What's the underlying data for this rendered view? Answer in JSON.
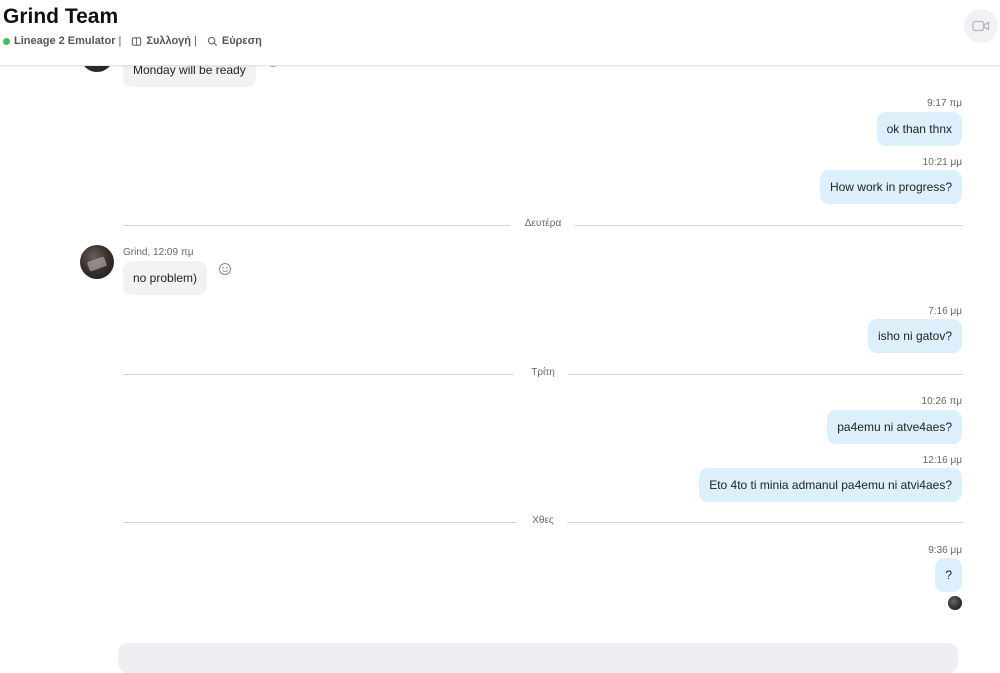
{
  "header": {
    "title": "Grind Team",
    "status_label": "Lineage 2 Emulator",
    "separator": "|",
    "collection_label": "Συλλογή",
    "find_label": "Εύρεση"
  },
  "messages": [
    {
      "text": "Monday will be ready"
    },
    {
      "time": "9:17 πμ",
      "text": "ok than thnx"
    },
    {
      "time": "10:21 μμ",
      "text": "How  work in progress?"
    },
    {
      "divider": "Δευτέρα"
    },
    {
      "sender_meta": "Grind, 12:09 πμ",
      "text": "no problem)"
    },
    {
      "time": "7:16 μμ",
      "text": "isho ni gatov?"
    },
    {
      "divider": "Τρίτη"
    },
    {
      "time": "10:26 πμ",
      "text": "pa4emu ni atve4aes?"
    },
    {
      "time": "12:16 μμ",
      "text": "Eto 4to ti minia admanul pa4emu ni atvi4aes?"
    },
    {
      "divider": "Χθες"
    },
    {
      "time": "9:36 μμ",
      "text": "?"
    }
  ],
  "colors": {
    "outgoing_bubble": "#dcf0fb",
    "incoming_bubble": "#f1f2f4",
    "online_dot": "#3fbf55",
    "composer_bg": "#efeff3"
  },
  "icons": [
    "book-icon",
    "search-icon",
    "video-call-icon",
    "emoji-reaction-icon",
    "read-receipt-avatar"
  ]
}
